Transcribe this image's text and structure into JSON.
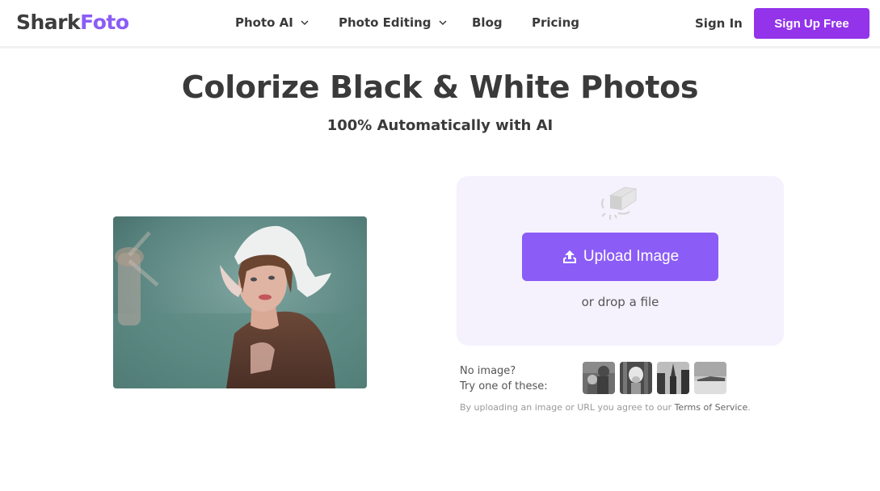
{
  "brand": {
    "name_part1": "Shark",
    "name_part2": "Foto",
    "accent_color": "#8b5cf6",
    "cta_color": "#9333ea"
  },
  "nav": {
    "items": [
      {
        "label": "Photo AI",
        "has_dropdown": true,
        "icon": "chevron-down-icon"
      },
      {
        "label": "Photo Editing",
        "has_dropdown": true,
        "icon": "chevron-down-icon"
      },
      {
        "label": "Blog",
        "has_dropdown": false
      },
      {
        "label": "Pricing",
        "has_dropdown": false
      }
    ],
    "signin_label": "Sign In",
    "signup_label": "Sign Up Free"
  },
  "hero": {
    "title": "Colorize Black & White Photos",
    "subtitle": "100% Automatically with AI"
  },
  "sample_image": {
    "description": "colorized vintage portrait of woman in Dutch lace bonnet with windmill background"
  },
  "upload": {
    "icon": "eraser-icon",
    "button_icon": "upload-icon",
    "button_label": "Upload Image",
    "drop_text": "or drop a file"
  },
  "samples": {
    "line1": "No image?",
    "line2": "Try one of these:",
    "thumbnails": [
      {
        "description": "two children black and white"
      },
      {
        "description": "dog behind fence black and white"
      },
      {
        "description": "church steeple black and white"
      },
      {
        "description": "landscape field black and white"
      }
    ]
  },
  "terms": {
    "prefix": "By uploading an image or URL you agree to our ",
    "link": "Terms of Service",
    "suffix": "."
  }
}
